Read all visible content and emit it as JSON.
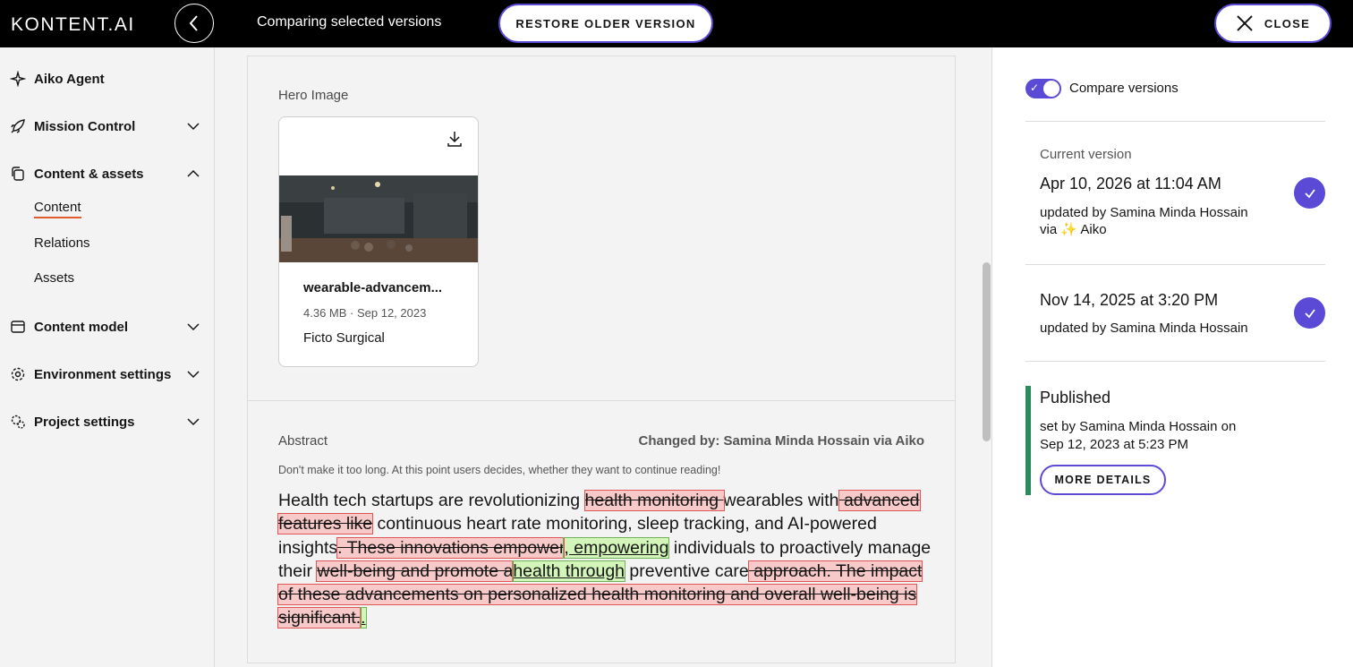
{
  "header": {
    "logo_text": "KONTENT.AI",
    "title": "Comparing selected versions",
    "restore_label": "RESTORE OLDER VERSION",
    "close_label": "CLOSE"
  },
  "sidebar": {
    "items": [
      {
        "label": "Aiko Agent",
        "icon": "sparkle-icon"
      },
      {
        "label": "Mission Control",
        "icon": "rocket-icon"
      },
      {
        "label": "Content & assets",
        "icon": "copy-icon"
      },
      {
        "label": "Content model",
        "icon": "layout-icon"
      },
      {
        "label": "Environment settings",
        "icon": "gear-icon"
      },
      {
        "label": "Project settings",
        "icon": "gears-icon"
      }
    ],
    "sub_items": [
      {
        "label": "Content",
        "active": true
      },
      {
        "label": "Relations"
      },
      {
        "label": "Assets"
      }
    ]
  },
  "hero": {
    "label": "Hero Image",
    "asset_name": "wearable-advancem...",
    "asset_meta": "4.36 MB · Sep 12, 2023",
    "asset_owner": "Ficto Surgical"
  },
  "abstract": {
    "label": "Abstract",
    "changed_by": "Changed by: Samina Minda Hossain via Aiko",
    "guideline": "Don't make it too long. At this point users decides, whether they want to continue reading!",
    "segments": [
      {
        "t": "Health tech startups are revolutionizing ",
        "k": "same"
      },
      {
        "t": "health monitoring ",
        "k": "del"
      },
      {
        "t": "wearables with",
        "k": "same"
      },
      {
        "t": " advanced features like",
        "k": "del"
      },
      {
        "t": " continuous heart rate monitoring, sleep tracking, and AI-powered insights",
        "k": "same"
      },
      {
        "t": ". These innovations empower",
        "k": "del"
      },
      {
        "t": ", empowering",
        "k": "ins"
      },
      {
        "t": " individuals to proactively manage their ",
        "k": "same"
      },
      {
        "t": "well-being and promote a",
        "k": "del"
      },
      {
        "t": "health through",
        "k": "ins"
      },
      {
        "t": " preventive care",
        "k": "same"
      },
      {
        "t": " approach. The impact of these advancements on personalized health monitoring and overall well-being is significant.",
        "k": "del"
      },
      {
        "t": ".",
        "k": "ins"
      }
    ]
  },
  "right_panel": {
    "toggle_label": "Compare versions",
    "toggle_on": true,
    "current_label": "Current version",
    "current_date": "Apr 10, 2026 at 11:04 AM",
    "current_by_line1": "updated by Samina Minda Hossain",
    "current_by_line2": "via ✨ Aiko",
    "older_date": "Nov 14, 2025 at 3:20 PM",
    "older_by": "updated by Samina Minda Hossain",
    "published_title": "Published",
    "published_by_line1": "set by Samina Minda Hossain on",
    "published_by_line2": "Sep 12, 2023 at 5:23 PM",
    "more_details": "MORE DETAILS"
  },
  "colors": {
    "accent": "#5b4ad6",
    "published": "#2a8c5b",
    "deleted_bg": "#f8c9c9",
    "inserted_bg": "#d4f5b9",
    "active_underline": "#e25c2b"
  }
}
